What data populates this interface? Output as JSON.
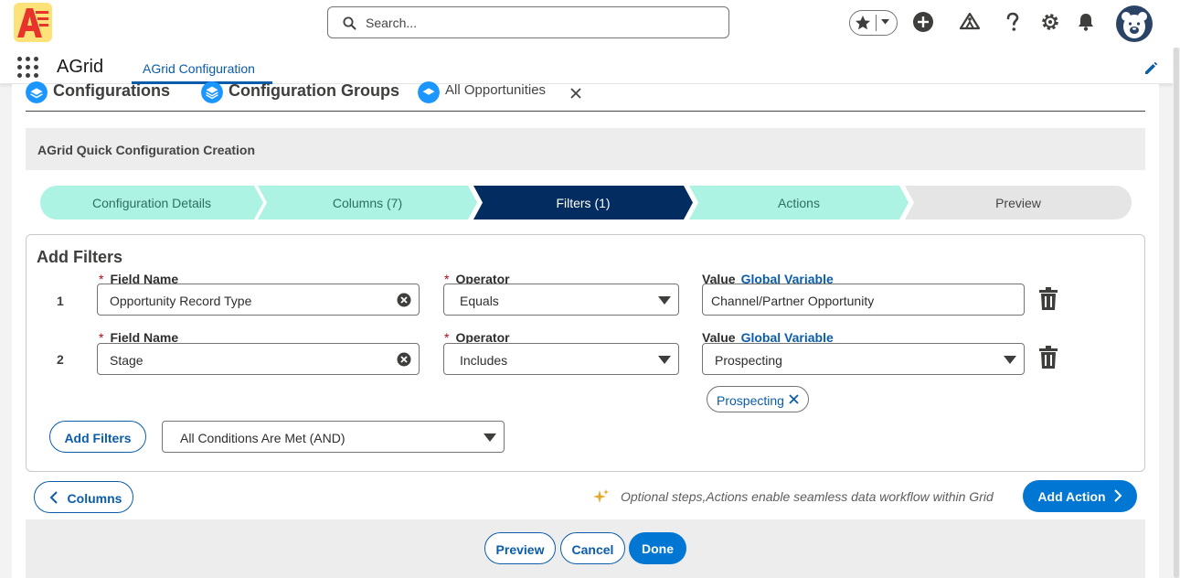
{
  "header": {
    "search_placeholder": "Search..."
  },
  "nav": {
    "app_name": "AGrid",
    "active_tab": "AGrid Configuration"
  },
  "breadcrumbs": [
    {
      "label": "Configurations"
    },
    {
      "label": "Configuration Groups"
    },
    {
      "label": "All Opportunities"
    }
  ],
  "section_title": "AGrid Quick Configuration Creation",
  "path_steps": [
    {
      "label": "Configuration Details",
      "state": "complete"
    },
    {
      "label": "Columns (7)",
      "state": "complete"
    },
    {
      "label": "Filters (1)",
      "state": "current"
    },
    {
      "label": "Actions",
      "state": "complete"
    },
    {
      "label": "Preview",
      "state": "incomplete"
    }
  ],
  "filters_panel": {
    "title": "Add Filters",
    "required_mark": "*",
    "field_name_label": "Field Name",
    "operator_label": "Operator",
    "value_label": "Value",
    "global_variable_link": "Global Variable",
    "rows": [
      {
        "num": "1",
        "field": "Opportunity Record Type",
        "operator": "Equals",
        "value": "Channel/Partner Opportunity"
      },
      {
        "num": "2",
        "field": "Stage",
        "operator": "Includes",
        "value": "Prospecting",
        "pill": "Prospecting"
      }
    ],
    "add_filters_button": "Add Filters",
    "logic_select": "All Conditions Are Met (AND)"
  },
  "step_nav": {
    "back_button": "Columns",
    "note": "Optional steps,Actions enable seamless data workflow within Grid",
    "next_button": "Add Action"
  },
  "footer": {
    "preview_button": "Preview",
    "cancel_button": "Cancel",
    "done_button": "Done"
  },
  "colors": {
    "brand_blue": "#0176d3",
    "link_blue": "#0b5cab",
    "path_complete": "#acf3e4",
    "path_current": "#032d60",
    "path_incomplete": "#e5e5e5"
  }
}
